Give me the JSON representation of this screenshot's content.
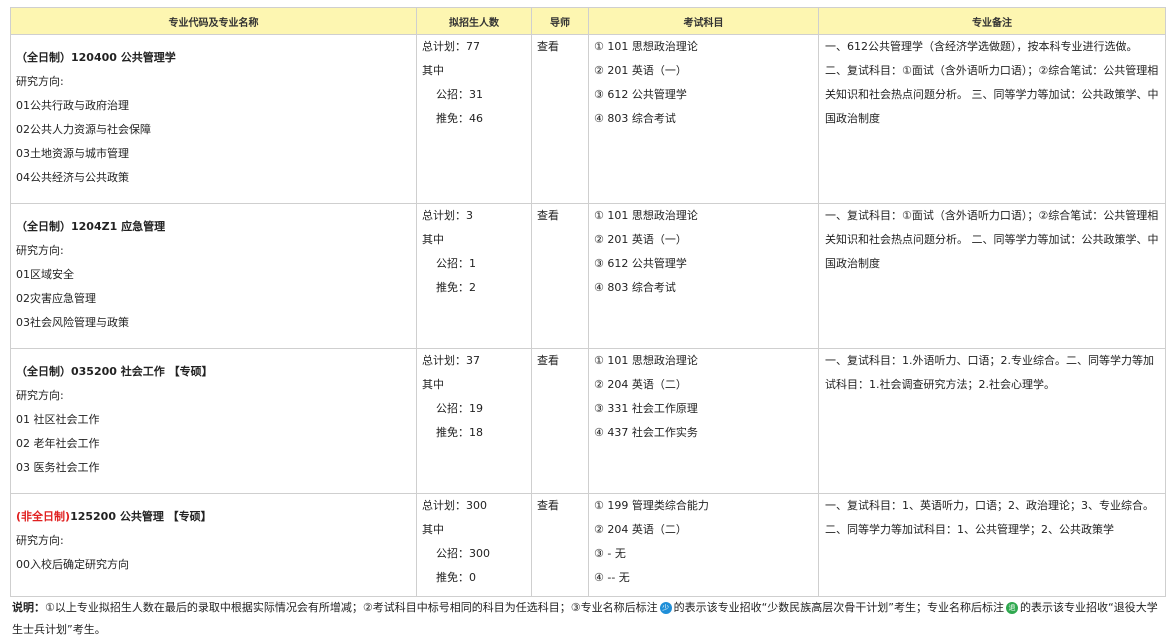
{
  "headers": [
    "专业代码及专业名称",
    "拟招生人数",
    "导师",
    "考试科目",
    "专业备注"
  ],
  "rows": [
    {
      "form": "（全日制）",
      "form_color": "#222222",
      "code_name": "120400 公共管理学",
      "research_label": "研究方向:",
      "directions": [
        "01公共行政与政府治理",
        "02公共人力资源与社会保障",
        "03土地资源与城市管理",
        "04公共经济与公共政策"
      ],
      "total": "总计划：77",
      "among": "其中",
      "public": "公招：31",
      "recommend": "推免：46",
      "tutor": "查看",
      "subjects": [
        "① 101 思想政治理论",
        "② 201 英语（一）",
        "③ 612 公共管理学",
        "④ 803 综合考试"
      ],
      "remark": "一、612公共管理学（含经济学选做题），按本科专业进行选做。 二、复试科目：①面试（含外语听力口语）；②综合笔试：公共管理相关知识和社会热点问题分析。 三、同等学力等加试：公共政策学、中国政治制度"
    },
    {
      "form": "（全日制）",
      "form_color": "#222222",
      "code_name": "1204Z1 应急管理",
      "research_label": "研究方向:",
      "directions": [
        "01区域安全",
        "02灾害应急管理",
        "03社会风险管理与政策"
      ],
      "total": "总计划：3",
      "among": "其中",
      "public": "公招：1",
      "recommend": "推免：2",
      "tutor": "查看",
      "subjects": [
        "① 101 思想政治理论",
        "② 201 英语（一）",
        "③ 612 公共管理学",
        "④ 803 综合考试"
      ],
      "remark": "一、复试科目：①面试（含外语听力口语）；②综合笔试：公共管理相关知识和社会热点问题分析。 二、同等学力等加试：公共政策学、中国政治制度"
    },
    {
      "form": "（全日制）",
      "form_color": "#222222",
      "code_name": "035200 社会工作 【专硕】",
      "research_label": "研究方向:",
      "directions": [
        "01 社区社会工作",
        "02 老年社会工作",
        "03 医务社会工作"
      ],
      "total": "总计划：37",
      "among": "其中",
      "public": "公招：19",
      "recommend": "推免：18",
      "tutor": "查看",
      "subjects": [
        "① 101 思想政治理论",
        "② 204 英语（二）",
        "③ 331 社会工作原理",
        "④ 437 社会工作实务"
      ],
      "remark": "一、复试科目：1.外语听力、口语；2.专业综合。二、同等学力等加试科目：1.社会调查研究方法；2.社会心理学。"
    },
    {
      "form": "(非全日制)",
      "form_color": "#e02020",
      "code_name": "125200 公共管理 【专硕】",
      "research_label": "研究方向:",
      "directions": [
        "00入校后确定研究方向"
      ],
      "total": "总计划：300",
      "among": "其中",
      "public": "公招：300",
      "recommend": "推免：0",
      "tutor": "查看",
      "subjects": [
        "① 199 管理类综合能力",
        "② 204 英语（二）",
        "③ - 无",
        "④ -- 无"
      ],
      "remark": "一、复试科目：1、英语听力，口语；2、政治理论；3、专业综合。 二、同等学力等加试科目：1、公共管理学；2、公共政策学"
    }
  ],
  "note": {
    "label": "说明：",
    "part1": "①以上专业拟招生人数在最后的录取中根据实际情况会有所增减；②考试科目中标号相同的科目为任选科目；③专业名称后标注",
    "badge1_color": "#1f8fd8",
    "part2": "的表示该专业招收“少数民族高层次骨干计划”考生；专业名称后标注",
    "badge2_color": "#2fa84f",
    "part3": "的表示该专业招收“退役大学生士兵计划”考生。"
  }
}
